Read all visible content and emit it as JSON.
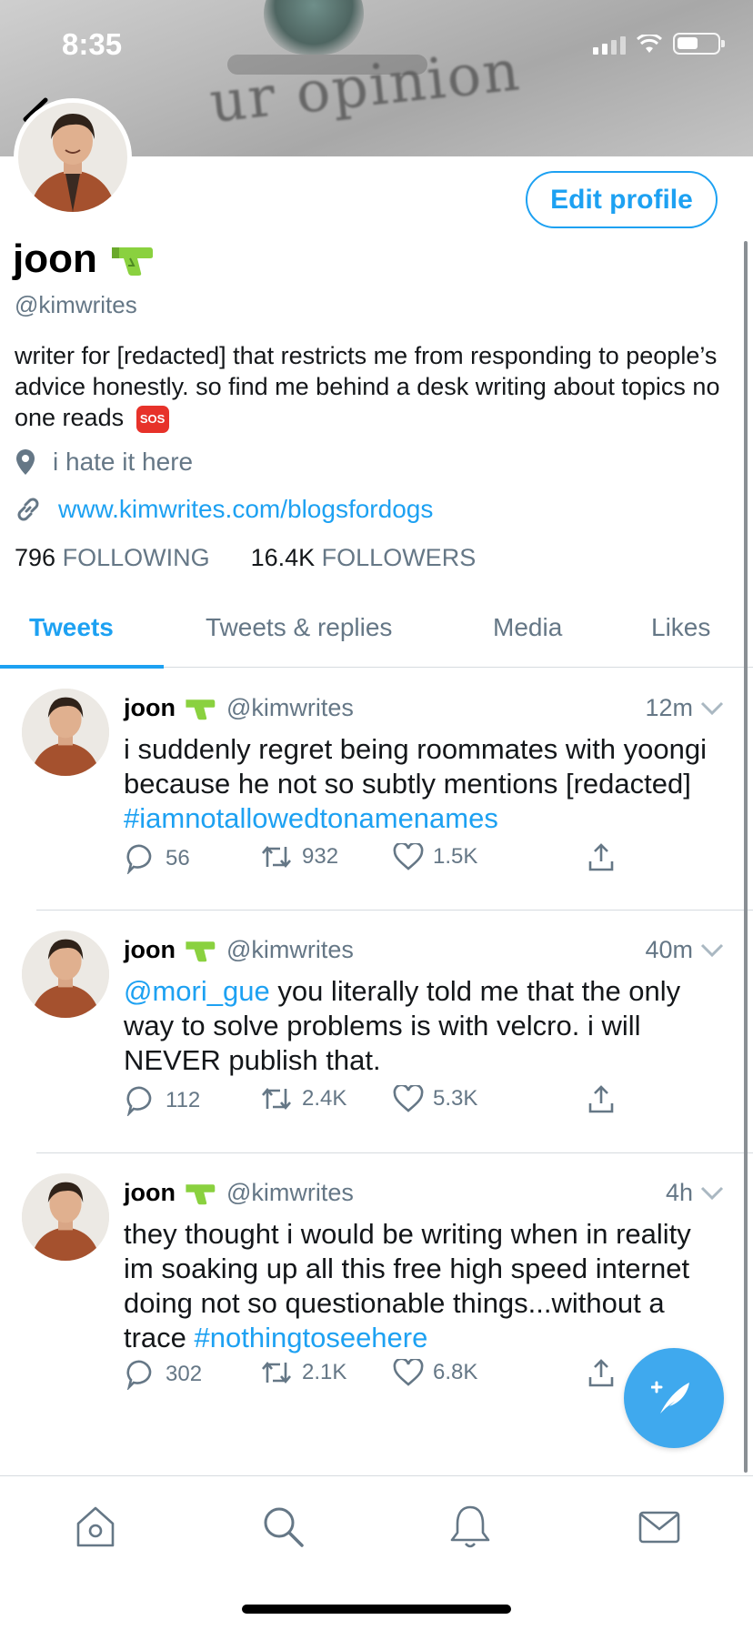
{
  "status_bar": {
    "time": "8:35"
  },
  "banner": {
    "text": "ur opinion"
  },
  "profile": {
    "name": "joon",
    "name_emoji_icon": "water-pistol-icon",
    "handle": "@kimwrites",
    "bio": "writer for [redacted] that restricts me from responding to people’s advice honestly. so find me behind a desk writing about topics no one reads",
    "bio_emoji": "SOS",
    "location": "i hate it here",
    "website": "www.kimwrites.com/blogsfordogs",
    "following_count": "796",
    "following_label": "FOLLOWING",
    "followers_count": "16.4K",
    "followers_label": "FOLLOWERS",
    "edit_button": "Edit profile"
  },
  "tabs": [
    {
      "label": "Tweets",
      "active": true
    },
    {
      "label": "Tweets & replies",
      "active": false
    },
    {
      "label": "Media",
      "active": false
    },
    {
      "label": "Likes",
      "active": false
    }
  ],
  "tweets": [
    {
      "name": "joon",
      "handle": "@kimwrites",
      "time": "12m",
      "text": "i suddenly regret being roommates with yoongi because he not so subtly mentions [redacted] ",
      "hashtag": "#iamnotallowedtonamenames",
      "replies": "56",
      "retweets": "932",
      "likes": "1.5K"
    },
    {
      "name": "joon",
      "handle": "@kimwrites",
      "time": "40m",
      "mention": "@mori_gue",
      "text": " you literally told me that the only way to solve problems is with velcro. i will NEVER publish that.",
      "replies": "112",
      "retweets": "2.4K",
      "likes": "5.3K"
    },
    {
      "name": "joon",
      "handle": "@kimwrites",
      "time": "4h",
      "text": "they thought i would be writing when in reality im soaking up all this free high speed internet doing not so questionable things...without a trace ",
      "hashtag": "#nothingtoseehere",
      "replies": "302",
      "retweets": "2.1K",
      "likes": "6.8K"
    }
  ],
  "colors": {
    "accent": "#1da1f2",
    "muted": "#657786",
    "divider": "#d6dbdf"
  },
  "nav": [
    "home-icon",
    "search-icon",
    "notifications-bell-icon",
    "messages-envelope-icon"
  ]
}
